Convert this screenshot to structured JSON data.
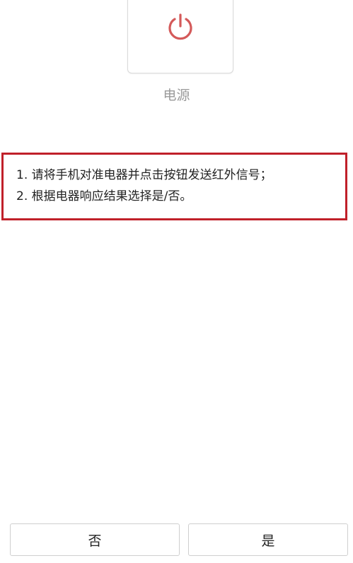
{
  "device": {
    "label": "电源",
    "icon": "power-icon",
    "icon_color": "#d45a5a"
  },
  "instructions": {
    "line1": "1. 请将手机对准电器并点击按钮发送红外信号；",
    "line2": "2. 根据电器响应结果选择是/否。",
    "border_color": "#c0202a"
  },
  "actions": {
    "no_label": "否",
    "yes_label": "是"
  }
}
